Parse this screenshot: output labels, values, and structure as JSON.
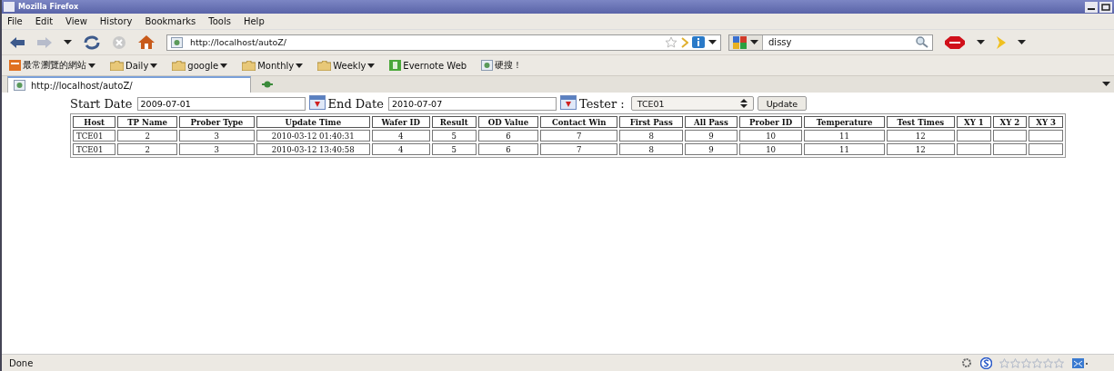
{
  "window": {
    "title": "Mozilla Firefox"
  },
  "menu": [
    "File",
    "Edit",
    "View",
    "History",
    "Bookmarks",
    "Tools",
    "Help"
  ],
  "address": {
    "value": "http://localhost/autoZ/"
  },
  "search": {
    "value": "dissy"
  },
  "bookmarks": [
    {
      "label": "最常瀏覽的網站",
      "kind": "menu"
    },
    {
      "label": "Daily",
      "kind": "folder"
    },
    {
      "label": "google",
      "kind": "folder"
    },
    {
      "label": "Monthly",
      "kind": "folder"
    },
    {
      "label": "Weekly",
      "kind": "folder"
    },
    {
      "label": "Evernote Web",
      "kind": "evernote"
    },
    {
      "label": "硬搜！",
      "kind": "page"
    }
  ],
  "tabs": [
    {
      "label": "http://localhost/autoZ/",
      "selected": true
    }
  ],
  "form": {
    "start_label": "Start Date",
    "start_value": "2009-07-01",
    "end_label": "End Date",
    "end_value": "2010-07-07",
    "tester_label": "Tester :",
    "tester_value": "TCE01",
    "button": "Update"
  },
  "table": {
    "columns": [
      "Host",
      "TP Name",
      "Prober Type",
      "Update Time",
      "Wafer ID",
      "Result",
      "OD Value",
      "Contact Win",
      "First Pass",
      "All Pass",
      "Prober ID",
      "Temperature",
      "Test Times",
      "XY 1",
      "XY 2",
      "XY 3"
    ],
    "rows": [
      [
        "TCE01",
        "2",
        "3",
        "2010-03-12 01:40:31",
        "4",
        "5",
        "6",
        "7",
        "8",
        "9",
        "10",
        "11",
        "12"
      ],
      [
        "TCE01",
        "2",
        "3",
        "2010-03-12 13:40:58",
        "4",
        "5",
        "6",
        "7",
        "8",
        "9",
        "10",
        "11",
        "12"
      ]
    ]
  },
  "status_bar": {
    "text": "Done"
  }
}
